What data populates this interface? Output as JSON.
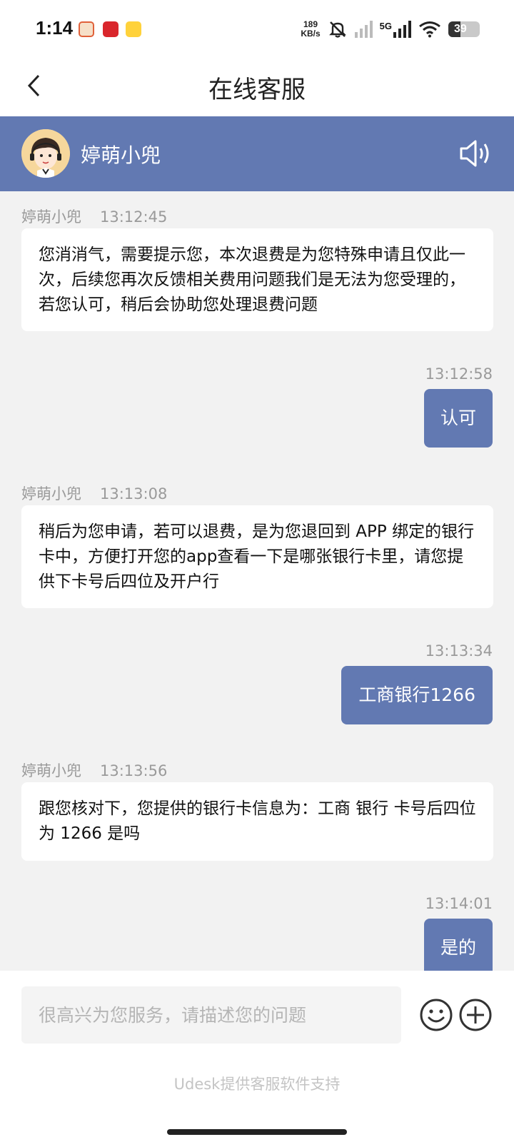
{
  "status_bar": {
    "time": "1:14",
    "net_speed_value": "189",
    "net_speed_unit": "KB/s",
    "network": "5G",
    "battery": "39"
  },
  "header": {
    "title": "在线客服"
  },
  "agent": {
    "name": "婷萌小兜"
  },
  "messages": [
    {
      "side": "in",
      "sender": "婷萌小兜",
      "time": "13:12:45",
      "text": "您消消气，需要提示您，本次退费是为您特殊申请且仅此一次，后续您再次反馈相关费用问题我们是无法为您受理的，若您认可，稍后会协助您处理退费问题"
    },
    {
      "side": "out",
      "time": "13:12:58",
      "text": "认可"
    },
    {
      "side": "in",
      "sender": "婷萌小兜",
      "time": "13:13:08",
      "text": "稍后为您申请，若可以退费，是为您退回到 APP 绑定的银行卡中，方便打开您的app查看一下是哪张银行卡里，请您提供下卡号后四位及开户行"
    },
    {
      "side": "out",
      "time": "13:13:34",
      "text": "工商银行1266"
    },
    {
      "side": "in",
      "sender": "婷萌小兜",
      "time": "13:13:56",
      "text": "跟您核对下，您提供的银行卡信息为：工商 银行 卡号后四位为 1266 是吗"
    },
    {
      "side": "out",
      "time": "13:14:01",
      "text": "是的"
    }
  ],
  "input": {
    "placeholder": "很高兴为您服务，请描述您的问题",
    "value": ""
  },
  "footer": {
    "powered_by": "Udesk提供客服软件支持"
  },
  "colors": {
    "accent": "#6279b2",
    "background": "#f2f2f2",
    "bubble_in": "#ffffff"
  },
  "icons": [
    "back-arrow-icon",
    "speaker-icon",
    "emoji-icon",
    "plus-icon",
    "wifi-icon",
    "mute-bell-icon",
    "signal-icon",
    "battery-icon"
  ]
}
